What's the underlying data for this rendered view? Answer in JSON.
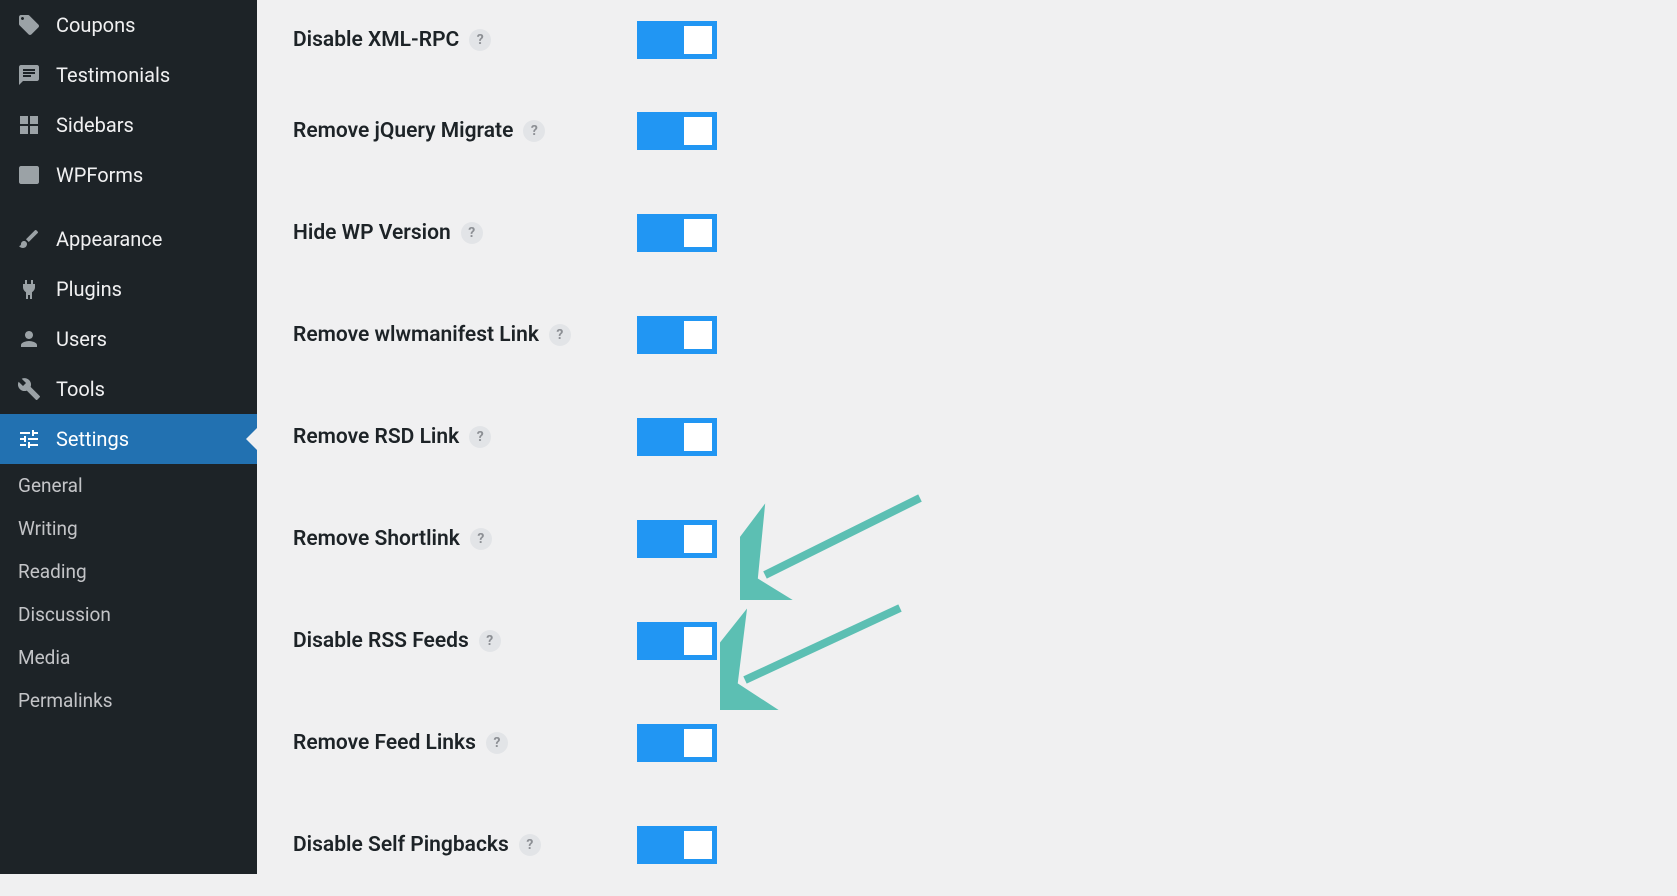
{
  "sidebar": {
    "items": [
      {
        "label": "Coupons",
        "icon": "tag"
      },
      {
        "label": "Testimonials",
        "icon": "chat"
      },
      {
        "label": "Sidebars",
        "icon": "grid"
      },
      {
        "label": "WPForms",
        "icon": "form"
      }
    ],
    "items2": [
      {
        "label": "Appearance",
        "icon": "brush"
      },
      {
        "label": "Plugins",
        "icon": "plug"
      },
      {
        "label": "Users",
        "icon": "user"
      },
      {
        "label": "Tools",
        "icon": "wrench"
      },
      {
        "label": "Settings",
        "icon": "sliders",
        "active": true
      }
    ],
    "submenu": [
      {
        "label": "General"
      },
      {
        "label": "Writing"
      },
      {
        "label": "Reading"
      },
      {
        "label": "Discussion"
      },
      {
        "label": "Media"
      },
      {
        "label": "Permalinks"
      }
    ]
  },
  "settings": [
    {
      "label": "Disable XML-RPC",
      "on": true
    },
    {
      "label": "Remove jQuery Migrate",
      "on": true
    },
    {
      "label": "Hide WP Version",
      "on": true
    },
    {
      "label": "Remove wlwmanifest Link",
      "on": true
    },
    {
      "label": "Remove RSD Link",
      "on": true
    },
    {
      "label": "Remove Shortlink",
      "on": true
    },
    {
      "label": "Disable RSS Feeds",
      "on": true
    },
    {
      "label": "Remove Feed Links",
      "on": true
    },
    {
      "label": "Disable Self Pingbacks",
      "on": true
    }
  ],
  "help_glyph": "?"
}
